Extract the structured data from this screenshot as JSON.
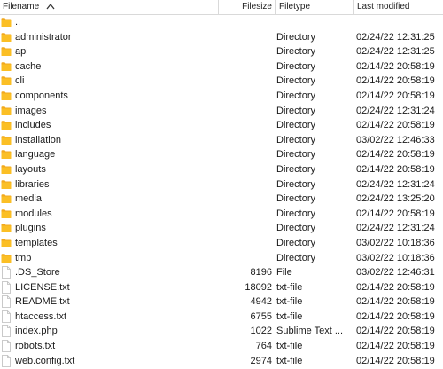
{
  "header": {
    "filename": "Filename",
    "filesize": "Filesize",
    "filetype": "Filetype",
    "last_modified": "Last modified"
  },
  "colors": {
    "folder": "#fbbf25",
    "folder_dark": "#f2a91d",
    "file_outline": "#bcbcbc"
  },
  "rows": [
    {
      "icon": "folder-icon",
      "name": "..",
      "size": "",
      "type": "",
      "modified": ""
    },
    {
      "icon": "folder-icon",
      "name": "administrator",
      "size": "",
      "type": "Directory",
      "modified": "02/24/22 12:31:25"
    },
    {
      "icon": "folder-icon",
      "name": "api",
      "size": "",
      "type": "Directory",
      "modified": "02/24/22 12:31:25"
    },
    {
      "icon": "folder-icon",
      "name": "cache",
      "size": "",
      "type": "Directory",
      "modified": "02/14/22 20:58:19"
    },
    {
      "icon": "folder-icon",
      "name": "cli",
      "size": "",
      "type": "Directory",
      "modified": "02/14/22 20:58:19"
    },
    {
      "icon": "folder-icon",
      "name": "components",
      "size": "",
      "type": "Directory",
      "modified": "02/14/22 20:58:19"
    },
    {
      "icon": "folder-icon",
      "name": "images",
      "size": "",
      "type": "Directory",
      "modified": "02/24/22 12:31:24"
    },
    {
      "icon": "folder-icon",
      "name": "includes",
      "size": "",
      "type": "Directory",
      "modified": "02/14/22 20:58:19"
    },
    {
      "icon": "folder-icon",
      "name": "installation",
      "size": "",
      "type": "Directory",
      "modified": "03/02/22 12:46:33"
    },
    {
      "icon": "folder-icon",
      "name": "language",
      "size": "",
      "type": "Directory",
      "modified": "02/14/22 20:58:19"
    },
    {
      "icon": "folder-icon",
      "name": "layouts",
      "size": "",
      "type": "Directory",
      "modified": "02/14/22 20:58:19"
    },
    {
      "icon": "folder-icon",
      "name": "libraries",
      "size": "",
      "type": "Directory",
      "modified": "02/24/22 12:31:24"
    },
    {
      "icon": "folder-icon",
      "name": "media",
      "size": "",
      "type": "Directory",
      "modified": "02/24/22 13:25:20"
    },
    {
      "icon": "folder-icon",
      "name": "modules",
      "size": "",
      "type": "Directory",
      "modified": "02/14/22 20:58:19"
    },
    {
      "icon": "folder-icon",
      "name": "plugins",
      "size": "",
      "type": "Directory",
      "modified": "02/24/22 12:31:24"
    },
    {
      "icon": "folder-icon",
      "name": "templates",
      "size": "",
      "type": "Directory",
      "modified": "03/02/22 10:18:36"
    },
    {
      "icon": "folder-icon",
      "name": "tmp",
      "size": "",
      "type": "Directory",
      "modified": "03/02/22 10:18:36"
    },
    {
      "icon": "file-icon",
      "name": ".DS_Store",
      "size": "8196",
      "type": "File",
      "modified": "03/02/22 12:46:31"
    },
    {
      "icon": "file-icon",
      "name": "LICENSE.txt",
      "size": "18092",
      "type": "txt-file",
      "modified": "02/14/22 20:58:19"
    },
    {
      "icon": "file-icon",
      "name": "README.txt",
      "size": "4942",
      "type": "txt-file",
      "modified": "02/14/22 20:58:19"
    },
    {
      "icon": "file-icon",
      "name": "htaccess.txt",
      "size": "6755",
      "type": "txt-file",
      "modified": "02/14/22 20:58:19"
    },
    {
      "icon": "file-icon",
      "name": "index.php",
      "size": "1022",
      "type": "Sublime Text ...",
      "modified": "02/14/22 20:58:19"
    },
    {
      "icon": "file-icon",
      "name": "robots.txt",
      "size": "764",
      "type": "txt-file",
      "modified": "02/14/22 20:58:19"
    },
    {
      "icon": "file-icon",
      "name": "web.config.txt",
      "size": "2974",
      "type": "txt-file",
      "modified": "02/14/22 20:58:19"
    }
  ]
}
